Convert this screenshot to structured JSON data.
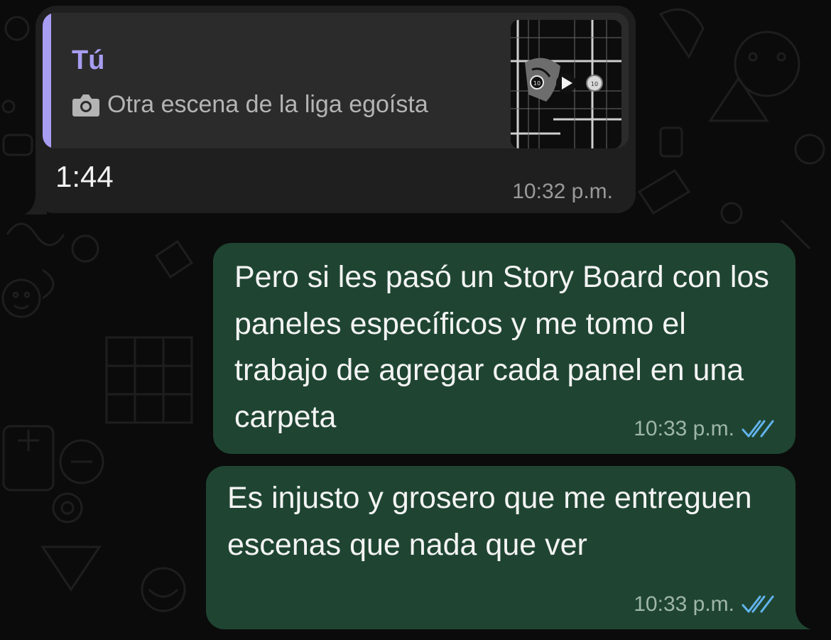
{
  "quoted_message": {
    "author": "Tú",
    "media_type_icon": "camera-icon",
    "caption": "Otra escena de la liga egoísta",
    "video_controls": {
      "rewind_seconds": "10",
      "play_icon": "play-icon",
      "forward_seconds": "10"
    }
  },
  "incoming_message": {
    "text": "1:44",
    "time": "10:32 p.m."
  },
  "outgoing_messages": [
    {
      "text": "Pero si les pasó un Story Board con los paneles específicos y me tomo el trabajo de agregar cada panel en una carpeta",
      "time": "10:33 p.m.",
      "status_icon": "double-check-read-icon"
    },
    {
      "text": "Es injusto y grosero que me entreguen escenas que nada que ver",
      "time": "10:33 p.m.",
      "status_icon": "double-check-read-icon"
    }
  ],
  "colors": {
    "background": "#0b0b0b",
    "incoming_bubble": "#1f1f1f",
    "quote_background": "#2b2b2b",
    "quote_accent": "#a79df2",
    "outgoing_bubble": "#1f4532",
    "read_ticks": "#62b4ee"
  }
}
